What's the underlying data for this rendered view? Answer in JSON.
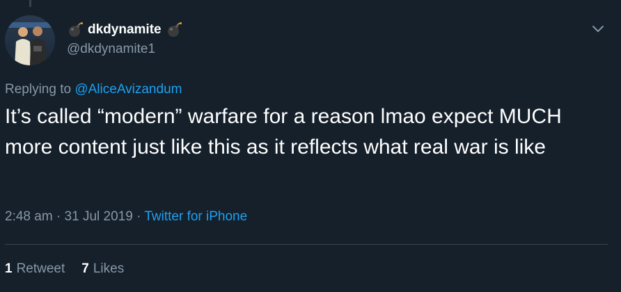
{
  "user": {
    "display_name": "dkdynamite",
    "handle": "@dkdynamite1",
    "name_icon": "bomb-icon"
  },
  "reply": {
    "prefix": "Replying to",
    "mention": "@AliceAvizandum"
  },
  "tweet": {
    "text": "It’s called “modern” warfare for a reason lmao expect MUCH more content just like this as it reflects what real war is like",
    "time": "2:48 am",
    "sep1": "·",
    "date": "31 Jul 2019",
    "sep2": "·",
    "source": "Twitter for iPhone"
  },
  "stats": {
    "retweets_count": "1",
    "retweets_label": "Retweet",
    "likes_count": "7",
    "likes_label": "Likes"
  },
  "colors": {
    "background": "#15202b",
    "primary_text": "#ffffff",
    "secondary_text": "#8899a6",
    "link": "#1da1f2",
    "divider": "#38444d"
  }
}
